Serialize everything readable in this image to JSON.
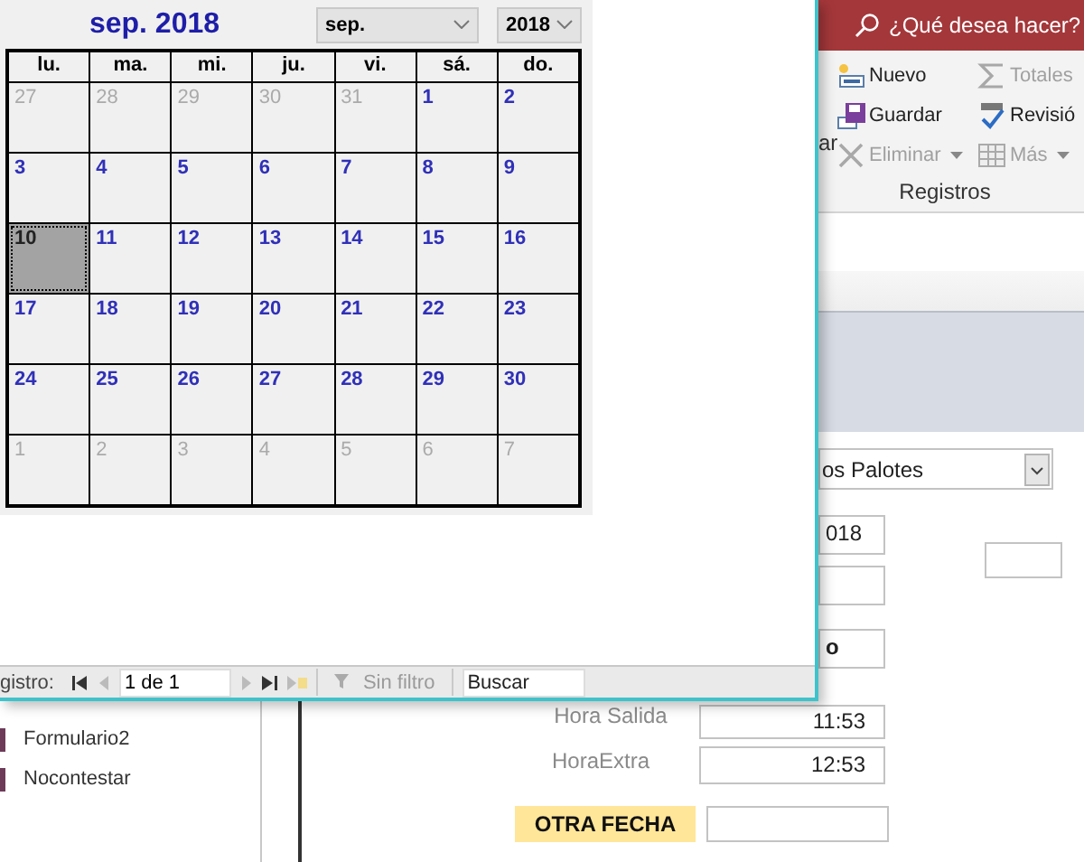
{
  "ribbon": {
    "search": "¿Qué desea hacer?",
    "cut_label": "ar",
    "buttons": [
      {
        "kind": "new",
        "label": "Nuevo",
        "disabled": false
      },
      {
        "kind": "totals",
        "label": "Totales",
        "disabled": true
      },
      {
        "kind": "save",
        "label": "Guardar",
        "disabled": false
      },
      {
        "kind": "spelling",
        "label": "Revisió",
        "disabled": false
      },
      {
        "kind": "delete",
        "label": "Eliminar",
        "disabled": true
      },
      {
        "kind": "more",
        "label": "Más",
        "disabled": true
      }
    ],
    "group": "Registros"
  },
  "nav_pane": {
    "items": [
      "Formulario2",
      "Nocontestar"
    ]
  },
  "form": {
    "controls": [
      {
        "kind": "combo",
        "value": "os Palotes"
      },
      {
        "kind": "field",
        "value": "018"
      },
      {
        "kind": "field"
      },
      {
        "kind": "field"
      },
      {
        "kind": "field",
        "value": "o",
        "bold": true
      },
      {
        "kind": "label",
        "text": "Hora Salida"
      },
      {
        "kind": "field",
        "value": "11:53"
      },
      {
        "kind": "label",
        "text": "HoraExtra"
      },
      {
        "kind": "field",
        "value": "12:53"
      },
      {
        "kind": "tag",
        "text": "OTRA FECHA"
      },
      {
        "kind": "field"
      }
    ]
  },
  "popup": {
    "calendar": {
      "title": "sep. 2018",
      "month": "sep.",
      "year": "2018",
      "weekdays": [
        "lu.",
        "ma.",
        "mi.",
        "ju.",
        "vi.",
        "sá.",
        "do."
      ],
      "days": [
        {
          "day": "27",
          "in_month": false,
          "selected": false
        },
        {
          "day": "28",
          "in_month": false,
          "selected": false
        },
        {
          "day": "29",
          "in_month": false,
          "selected": false
        },
        {
          "day": "30",
          "in_month": false,
          "selected": false
        },
        {
          "day": "31",
          "in_month": false,
          "selected": false
        },
        {
          "day": "1",
          "in_month": true,
          "selected": false
        },
        {
          "day": "2",
          "in_month": true,
          "selected": false
        },
        {
          "day": "3",
          "in_month": true,
          "selected": false
        },
        {
          "day": "4",
          "in_month": true,
          "selected": false
        },
        {
          "day": "5",
          "in_month": true,
          "selected": false
        },
        {
          "day": "6",
          "in_month": true,
          "selected": false
        },
        {
          "day": "7",
          "in_month": true,
          "selected": false
        },
        {
          "day": "8",
          "in_month": true,
          "selected": false
        },
        {
          "day": "9",
          "in_month": true,
          "selected": false
        },
        {
          "day": "10",
          "in_month": true,
          "selected": true
        },
        {
          "day": "11",
          "in_month": true,
          "selected": false
        },
        {
          "day": "12",
          "in_month": true,
          "selected": false
        },
        {
          "day": "13",
          "in_month": true,
          "selected": false
        },
        {
          "day": "14",
          "in_month": true,
          "selected": false
        },
        {
          "day": "15",
          "in_month": true,
          "selected": false
        },
        {
          "day": "16",
          "in_month": true,
          "selected": false
        },
        {
          "day": "17",
          "in_month": true,
          "selected": false
        },
        {
          "day": "18",
          "in_month": true,
          "selected": false
        },
        {
          "day": "19",
          "in_month": true,
          "selected": false
        },
        {
          "day": "20",
          "in_month": true,
          "selected": false
        },
        {
          "day": "21",
          "in_month": true,
          "selected": false
        },
        {
          "day": "22",
          "in_month": true,
          "selected": false
        },
        {
          "day": "23",
          "in_month": true,
          "selected": false
        },
        {
          "day": "24",
          "in_month": true,
          "selected": false
        },
        {
          "day": "25",
          "in_month": true,
          "selected": false
        },
        {
          "day": "26",
          "in_month": true,
          "selected": false
        },
        {
          "day": "27",
          "in_month": true,
          "selected": false
        },
        {
          "day": "28",
          "in_month": true,
          "selected": false
        },
        {
          "day": "29",
          "in_month": true,
          "selected": false
        },
        {
          "day": "30",
          "in_month": true,
          "selected": false
        },
        {
          "day": "1",
          "in_month": false,
          "selected": false
        },
        {
          "day": "2",
          "in_month": false,
          "selected": false
        },
        {
          "day": "3",
          "in_month": false,
          "selected": false
        },
        {
          "day": "4",
          "in_month": false,
          "selected": false
        },
        {
          "day": "5",
          "in_month": false,
          "selected": false
        },
        {
          "day": "6",
          "in_month": false,
          "selected": false
        },
        {
          "day": "7",
          "in_month": false,
          "selected": false
        }
      ]
    },
    "record_nav": {
      "label": "gistro:",
      "position": "1 de 1",
      "filter": "Sin filtro",
      "search": "Buscar"
    }
  }
}
